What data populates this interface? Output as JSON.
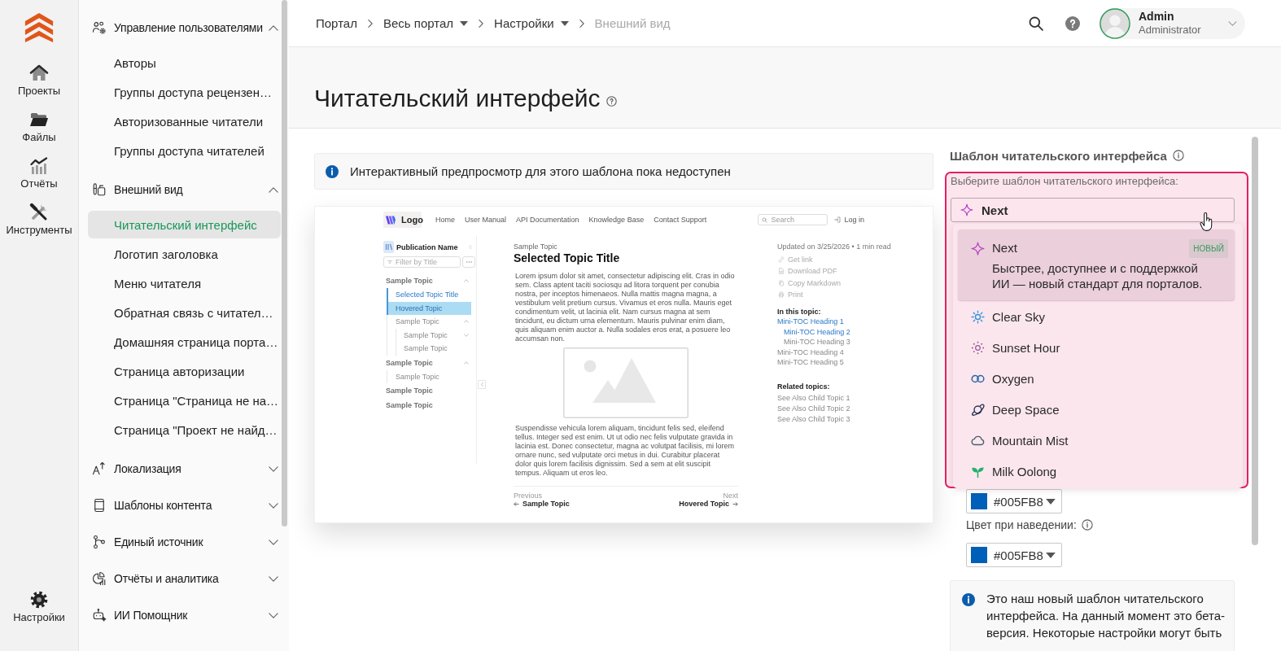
{
  "rail": {
    "items": [
      {
        "label": "Проекты"
      },
      {
        "label": "Файлы"
      },
      {
        "label": "Отчёты"
      },
      {
        "label": "Инструменты"
      }
    ],
    "bottom_item": {
      "label": "Настройки"
    }
  },
  "sidebar": {
    "groups": [
      {
        "label": "Управление пользователями",
        "expanded": true,
        "items": [
          {
            "label": "Авторы",
            "selected": false
          },
          {
            "label": "Группы доступа рецензен…",
            "selected": false
          },
          {
            "label": "Авторизованные читатели",
            "selected": false
          },
          {
            "label": "Группы доступа читателей",
            "selected": false
          }
        ]
      },
      {
        "label": "Внешний вид",
        "expanded": true,
        "items": [
          {
            "label": "Читательский интерфейс",
            "selected": true
          },
          {
            "label": "Логотип заголовка",
            "selected": false
          },
          {
            "label": "Меню читателя",
            "selected": false
          },
          {
            "label": "Обратная связь с читател…",
            "selected": false
          },
          {
            "label": "Домашняя страница порта…",
            "selected": false
          },
          {
            "label": "Страница авторизации",
            "selected": false
          },
          {
            "label": "Страница \"Страница не на…",
            "selected": false
          },
          {
            "label": "Страница \"Проект не найд…",
            "selected": false
          }
        ]
      },
      {
        "label": "Локализация",
        "expanded": false
      },
      {
        "label": "Шаблоны контента",
        "expanded": false
      },
      {
        "label": "Единый источник",
        "expanded": false
      },
      {
        "label": "Отчёты и аналитика",
        "expanded": false
      },
      {
        "label": "ИИ Помощник",
        "expanded": false
      }
    ]
  },
  "breadcrumbs": [
    {
      "label": "Портал",
      "dropdown": false,
      "current": false
    },
    {
      "label": "Весь портал",
      "dropdown": true,
      "current": false
    },
    {
      "label": "Настройки",
      "dropdown": true,
      "current": false
    },
    {
      "label": "Внешний вид",
      "dropdown": false,
      "current": true
    }
  ],
  "user": {
    "name": "Admin",
    "role": "Administrator"
  },
  "page": {
    "title": "Читательский интерфейс"
  },
  "notice": {
    "text": "Интерактивный предпросмотр для этого шаблона пока недоступен"
  },
  "preview": {
    "logo": "Logo",
    "nav": [
      "Home",
      "User Manual",
      "API Documentation",
      "Knowledge Base",
      "Contact Support"
    ],
    "search_placeholder": "Search",
    "login": "Log in",
    "publication": "Publication Name",
    "filter_placeholder": "Filter by Title",
    "tree": [
      {
        "label": "Sample Topic",
        "selected": false,
        "hovered": false,
        "expanded": true,
        "children": [
          {
            "label": "Selected Topic Title",
            "selected": true,
            "hovered": false
          },
          {
            "label": "Hovered Topic",
            "selected": false,
            "hovered": true
          },
          {
            "label": "Sample Topic",
            "selected": false,
            "hovered": false,
            "expanded": true,
            "children": [
              {
                "label": "Sample Topic",
                "selected": false,
                "hovered": false,
                "expanded": false
              },
              {
                "label": "Sample Topic",
                "selected": false,
                "hovered": false
              }
            ]
          }
        ]
      },
      {
        "label": "Sample Topic",
        "selected": false,
        "hovered": false,
        "expanded": true,
        "children": [
          {
            "label": "Sample Topic",
            "selected": false,
            "hovered": false
          }
        ]
      },
      {
        "label": "Sample Topic",
        "selected": false,
        "hovered": false
      },
      {
        "label": "Sample Topic",
        "selected": false,
        "hovered": false
      }
    ],
    "breadcrumb": "Sample Topic",
    "title": "Selected Topic Title",
    "paragraphs": [
      "Lorem ipsum dolor sit amet, consectetur adipiscing elit. Cras in odio sem. Class aptent taciti sociosqu ad litora torquent per conubia nostra, per inceptos himenaeos. Nulla mattis magna magna, a vestibulum velit pretium cursus. Vivamus et eros nulla. Mauris eget condimentum velit, ut lacinia elit. Nam cursus magna at sem tincidunt, eu dictum urna elementum. Mauris pulvinar enim diam, quis aliquam enim auctor a. Nulla sodales eros erat, a posuere leo accumsan non.",
      "Suspendisse vehicula lorem aliquam, tincidunt felis sed, eleifend tellus. Integer sed est enim. Ut ut odio nec felis vulputate gravida in lacinia est. Donec consectetur, magna ac volutpat facilisis, mi lorem ornare nunc, sed vulputate orci metus in dui. Curabitur placerat dolor quis lorem facilisis dignissim. Sed a sem at elit suscipit tempus. Aliquam ut eros leo."
    ],
    "previous": {
      "caption": "Previous",
      "label": "Sample Topic"
    },
    "next": {
      "caption": "Next",
      "label": "Hovered Topic"
    },
    "updated": "Updated on 3/25/2026 • 1 min read",
    "actions": [
      "Get link",
      "Download PDF",
      "Copy Markdown",
      "Print"
    ],
    "toc_heading": "In this topic:",
    "toc": [
      {
        "label": "Mini-TOC Heading 1",
        "active": true,
        "children": [
          {
            "label": "Mini-TOC Heading 2",
            "active": true
          },
          {
            "label": "Mini-TOC Heading 3",
            "active": false
          }
        ]
      },
      {
        "label": "Mini-TOC Heading 4",
        "active": false
      },
      {
        "label": "Mini-TOC Heading 5",
        "active": false
      }
    ],
    "related_heading": "Related topics:",
    "related": [
      "See Also Child Topic 1",
      "See Also Child Topic 2",
      "See Also Child Topic 3"
    ]
  },
  "template_panel": {
    "heading": "Шаблон читательского интерфейса",
    "field_label": "Выберите шаблон читательского интерфейса:",
    "value": "Next",
    "options": [
      {
        "label": "Next",
        "selected": true,
        "badge": "НОВЫЙ",
        "description": "Быстрее, доступнее и с поддержкой ИИ — новый стандарт для порталов."
      },
      {
        "label": "Clear Sky",
        "selected": false
      },
      {
        "label": "Sunset Hour",
        "selected": false
      },
      {
        "label": "Oxygen",
        "selected": false
      },
      {
        "label": "Deep Space",
        "selected": false
      },
      {
        "label": "Mountain Mist",
        "selected": false
      },
      {
        "label": "Milk Oolong",
        "selected": false
      }
    ],
    "colors": [
      {
        "value": "#005FB8",
        "color": "#005fb8"
      },
      {
        "label": "Цвет при наведении:",
        "value": "#005FB8",
        "color": "#005fb8"
      }
    ],
    "note": "Это наш новый шаблон читательского интерфейса. На данный момент это бета-версия. Некоторые настройки могут быть"
  }
}
